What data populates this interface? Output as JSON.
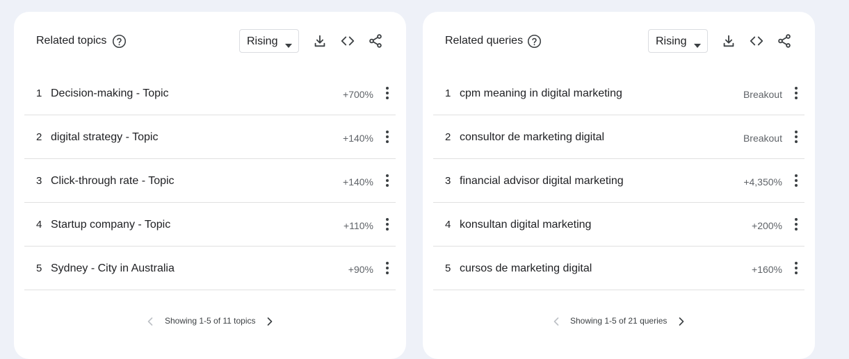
{
  "colors": {
    "background": "#eef1f8",
    "card": "#ffffff",
    "icon": "#3c4043",
    "muted_icon": "#bdc1c6",
    "value_text": "#5f6368"
  },
  "topics": {
    "title": "Related topics",
    "dropdown": "Rising",
    "icons": [
      "help-circle-icon",
      "download-icon",
      "embed-code-icon",
      "share-icon"
    ],
    "rows": [
      {
        "rank": "1",
        "label": "Decision-making - Topic",
        "value": "+700%"
      },
      {
        "rank": "2",
        "label": "digital strategy - Topic",
        "value": "+140%"
      },
      {
        "rank": "3",
        "label": "Click-through rate - Topic",
        "value": "+140%"
      },
      {
        "rank": "4",
        "label": "Startup company - Topic",
        "value": "+110%"
      },
      {
        "rank": "5",
        "label": "Sydney - City in Australia",
        "value": "+90%"
      }
    ],
    "pager": "Showing 1-5 of 11 topics"
  },
  "queries": {
    "title": "Related queries",
    "dropdown": "Rising",
    "icons": [
      "help-circle-icon",
      "download-icon",
      "embed-code-icon",
      "share-icon"
    ],
    "rows": [
      {
        "rank": "1",
        "label": "cpm meaning in digital marketing",
        "value": "Breakout"
      },
      {
        "rank": "2",
        "label": "consultor de marketing digital",
        "value": "Breakout"
      },
      {
        "rank": "3",
        "label": "financial advisor digital marketing",
        "value": "+4,350%"
      },
      {
        "rank": "4",
        "label": "konsultan digital marketing",
        "value": "+200%"
      },
      {
        "rank": "5",
        "label": "cursos de marketing digital",
        "value": "+160%"
      }
    ],
    "pager": "Showing 1-5 of 21 queries"
  }
}
